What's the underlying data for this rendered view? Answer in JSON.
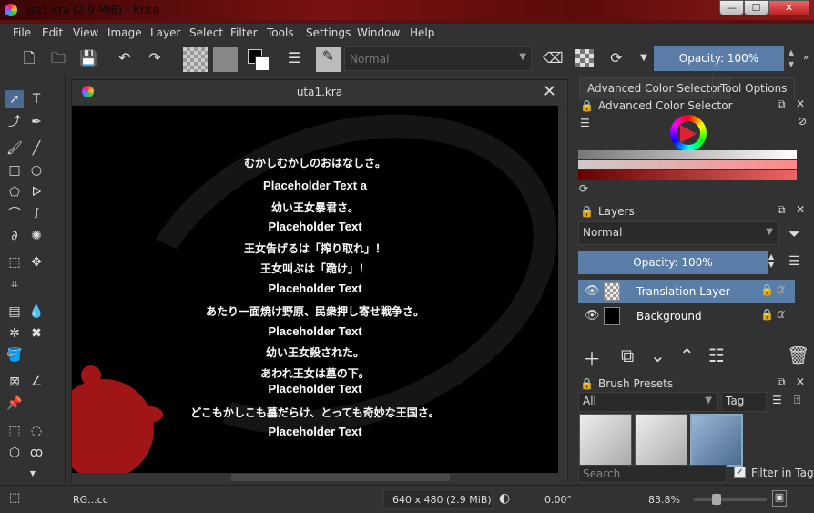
{
  "window": {
    "title": "uta1.kra (2.9 MiB)  - Krita",
    "min": "—",
    "max": "☐",
    "close": "✕"
  },
  "menu": [
    "File",
    "Edit",
    "View",
    "Image",
    "Layer",
    "Select",
    "Filter",
    "Tools",
    "Settings",
    "Window",
    "Help"
  ],
  "toolbar": {
    "blend_mode": "Normal",
    "opacity": "Opacity: 100%"
  },
  "document": {
    "tab_title": "uta1.kra",
    "lines": [
      {
        "text": "むかしむかしのおはなしさ。",
        "type": "jp"
      },
      {
        "text": "Placeholder Text a",
        "type": "ph"
      },
      {
        "text": "幼い王女暴君さ。",
        "type": "jp"
      },
      {
        "text": "Placeholder Text",
        "type": "ph"
      },
      {
        "text": "王女告げるは「搾り取れ」！",
        "type": "jp"
      },
      {
        "text": "王女叫ぶは「跪け」！",
        "type": "jp"
      },
      {
        "text": "Placeholder Text",
        "type": "ph"
      },
      {
        "text": "あたり一面焼け野原、民衆押し寄せ戦争さ。",
        "type": "jp"
      },
      {
        "text": "Placeholder Text",
        "type": "ph"
      },
      {
        "text": "幼い王女殺された。",
        "type": "jp"
      },
      {
        "text": "あわれ王女は墓の下。",
        "type": "jp"
      },
      {
        "text": "Placeholder Text",
        "type": "ph"
      },
      {
        "text": "どこもかしこも墓だらけ、とっても奇妙な王国さ。",
        "type": "jp"
      },
      {
        "text": "Placeholder Text",
        "type": "ph"
      }
    ]
  },
  "dock": {
    "tabs": [
      "Advanced Color Selector",
      "Tool Options"
    ],
    "color_panel_title": "Advanced Color Selector",
    "layers_title": "Layers",
    "layer_blend": "Normal",
    "layer_opacity": "Opacity:  100%",
    "layers": [
      {
        "name": "Translation Layer",
        "selected": true
      },
      {
        "name": "Background",
        "selected": false
      }
    ],
    "brush_title": "Brush Presets",
    "brush_filter": "All",
    "tag_label": "Tag",
    "search_placeholder": "Search",
    "filter_in_tag": "Filter in Tag"
  },
  "status": {
    "color_model": "RG...cc",
    "size": "640 x 480 (2.9 MiB)",
    "rotation": "0.00°",
    "zoom": "83.8%"
  },
  "colors": {
    "accent": "#5a7ea8",
    "splatter": "#a01515"
  }
}
